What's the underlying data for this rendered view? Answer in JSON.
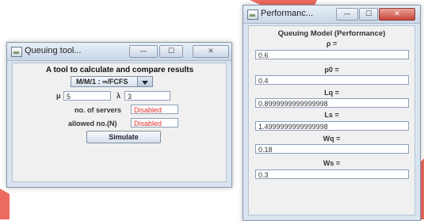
{
  "colors": {
    "accent_shape": "#ec6a5e",
    "disabled_text": "#e0302a"
  },
  "queuing_window": {
    "title": "Queuing tool...",
    "controls": {
      "minimize": "—",
      "maximize": "☐",
      "close": "✕"
    },
    "heading": "A tool to calculate and compare results",
    "model_select": {
      "value": "M/M/1 : ∞/FCFS",
      "arrow_icon": "chevron-down-icon"
    },
    "mu": {
      "label": "μ",
      "value": "5"
    },
    "lambda": {
      "label": "λ",
      "value": "3"
    },
    "servers": {
      "label": "no. of servers",
      "value": "Disabled"
    },
    "allowed": {
      "label": "allowed no.(N)",
      "value": "Disabled"
    },
    "simulate_label": "Simulate"
  },
  "performance_window": {
    "title": "Performanc...",
    "controls": {
      "minimize": "—",
      "maximize": "☐",
      "close": "✕"
    },
    "heading": "Queuing Model (Performance)",
    "metrics": [
      {
        "label": "ρ =",
        "value": "0.6"
      },
      {
        "label": "p0 =",
        "value": "0.4"
      },
      {
        "label": "Lq =",
        "value": "0.8999999999999998"
      },
      {
        "label": "Ls =",
        "value": "1.4999999999999998"
      },
      {
        "label": "Wq =",
        "value": "0.18"
      },
      {
        "label": "Ws =",
        "value": "0.3"
      }
    ]
  }
}
